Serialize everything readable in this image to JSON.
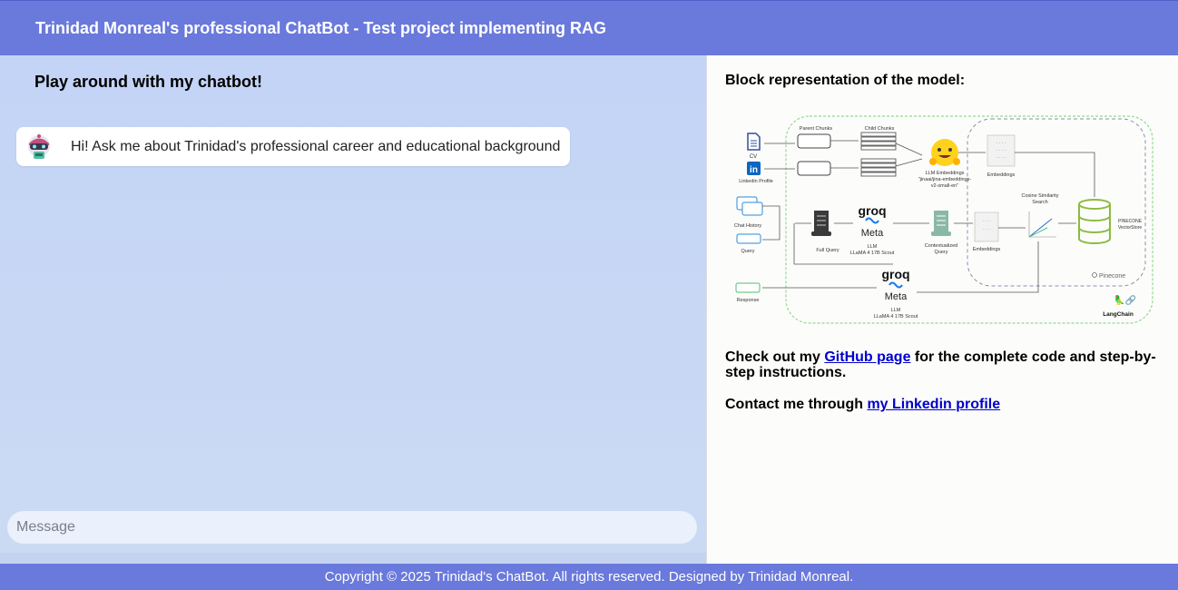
{
  "header": {
    "title": "Trinidad Monreal's professional ChatBot - Test project implementing RAG"
  },
  "chat": {
    "heading": "Play around with my chatbot!",
    "messages": [
      {
        "text": "Hi! Ask me about Trinidad's professional career and educational background"
      }
    ],
    "input": {
      "placeholder": "Message",
      "value": ""
    }
  },
  "sidebar": {
    "heading": "Block representation of the model:",
    "github": {
      "before": "Check out my ",
      "link": "GitHub page",
      "after": " for the complete code and step-by-step instructions."
    },
    "contact": {
      "before": "Contact me through ",
      "link": "my Linkedin profile"
    },
    "diagram": {
      "cv": "CV",
      "linkedin": "Linkedin Profile",
      "parent_chunks": "Parent Chunks",
      "child_chunks": "Child Chunks",
      "llm_embeddings": "LLM Embeddings",
      "embedding_model": "\"jinaai/jina-embeddings-",
      "embedding_model_2": "v2-small-en\"",
      "embeddings": "Embeddings",
      "chat_history": "Chat History",
      "query": "Query",
      "full_query": "Full Query",
      "groq": "groq",
      "meta": "Meta",
      "llm": "LLM",
      "llm_model": "LLaMA 4 17B Scout",
      "contextualized": "Contextualized",
      "contextualized_2": "Query",
      "cosine": "Cosine Similarity",
      "cosine_2": "Search",
      "embeddings_2": "Embeddings",
      "pinecone_store": "PINECONE",
      "pinecone_store_2": "VectorStore",
      "pinecone": "Pinecone",
      "response": "Response",
      "langchain": "LangChain"
    }
  },
  "footer": {
    "copyright": "Copyright © 2025 Trinidad's ChatBot. All rights reserved. Designed by Trinidad Monreal."
  },
  "colors": {
    "header_bg": "#6a79dc",
    "chat_bg": "#c3d4f6",
    "link": "#0000cc"
  }
}
